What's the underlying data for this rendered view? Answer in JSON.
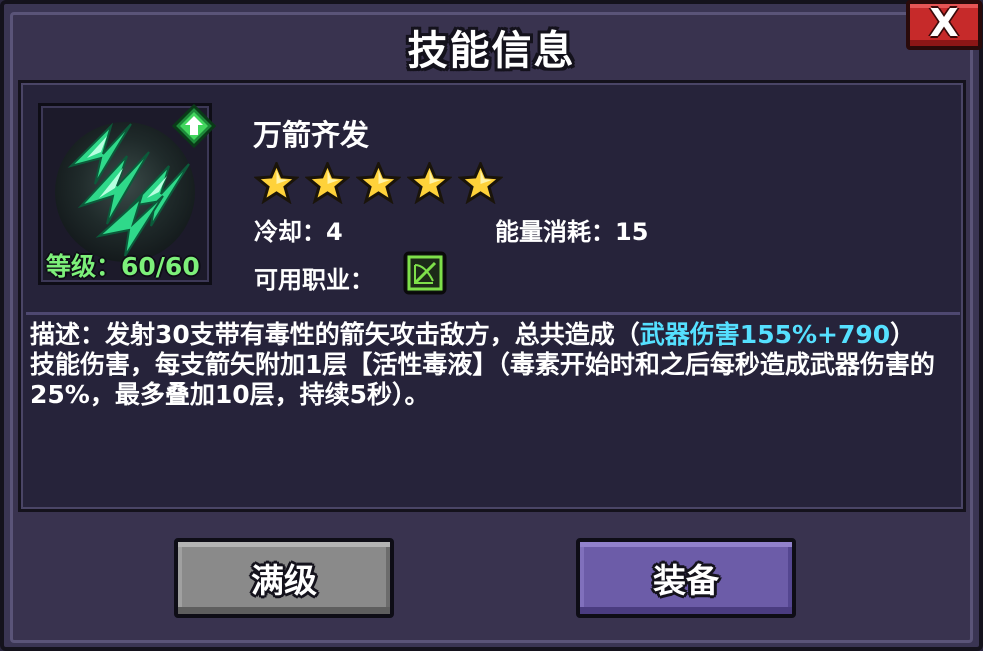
{
  "dialog": {
    "title": "技能信息",
    "close_label": "X"
  },
  "skill": {
    "name": "万箭齐发",
    "icon": "green-arrows-orb-icon",
    "upgrade_icon": "green-upgrade-arrow-icon",
    "level_text": "等级：60/60",
    "level": 60,
    "level_max": 60,
    "stars": 5,
    "stars_max": 5,
    "cooldown_label": "冷却：",
    "cooldown_value": "4",
    "energy_label": "能量消耗：",
    "energy_value": "15",
    "class_label": "可用职业：",
    "class_icon": "archer-bow-class-icon"
  },
  "description": {
    "part1": "描述：发射30支带有毒性的箭矢攻击敌方，总共造成（",
    "highlight": "武器伤害155%+790",
    "part2": "）技能伤害，每支箭矢附加1层【活性毒液】（毒素开始时和之后每秒造成武器伤害的25%，最多叠加10层，持续5秒）。"
  },
  "buttons": {
    "max_level": "满级",
    "equip": "装备"
  },
  "colors": {
    "highlight": "#55e0ff",
    "level_text": "#7df07a",
    "close_button": "#c62a2a",
    "equip_button": "#6c5ca8",
    "max_button": "#8a8a8a"
  }
}
